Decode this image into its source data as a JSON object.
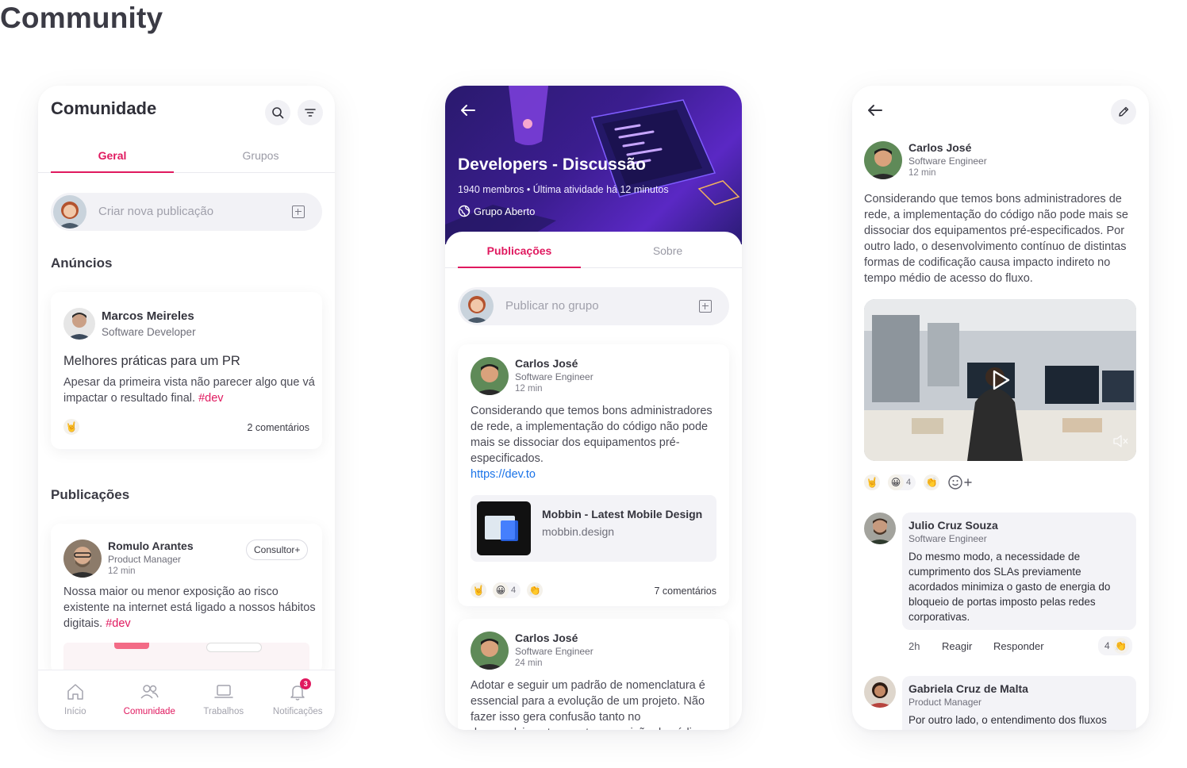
{
  "page": {
    "title": "Community"
  },
  "colors": {
    "accent": "#e0195f",
    "link": "#1a73e8"
  },
  "screen1": {
    "title": "Comunidade",
    "tabs": [
      {
        "label": "Geral",
        "active": true
      },
      {
        "label": "Grupos",
        "active": false
      }
    ],
    "composer_placeholder": "Criar nova publicação",
    "announcements_heading": "Anúncios",
    "announcement": {
      "author": "Marcos Meireles",
      "role": "Software Developer",
      "title": "Melhores práticas para um PR",
      "body": "Apesar da primeira vista não parecer algo que vá impactar o resultado final.",
      "tag": "#dev",
      "comments": "2 comentários"
    },
    "posts_heading": "Publicações",
    "post": {
      "author": "Romulo Arantes",
      "role": "Product Manager",
      "time": "12 min",
      "badge": "Consultor+",
      "body": "Nossa maior ou menor exposição ao risco existente na internet está ligado a nossos hábitos digitais.",
      "tag": "#dev"
    },
    "nav": [
      {
        "label": "Início",
        "icon": "home-icon",
        "active": false
      },
      {
        "label": "Comunidade",
        "icon": "people-icon",
        "active": true
      },
      {
        "label": "Trabalhos",
        "icon": "laptop-icon",
        "active": false
      },
      {
        "label": "Notificações",
        "icon": "bell-icon",
        "active": false,
        "badge": "3"
      }
    ]
  },
  "screen2": {
    "group_title": "Developers - Discussão",
    "group_meta": "1940 membros • Última atividade há 12 minutos",
    "group_type": "Grupo Aberto",
    "tabs": [
      {
        "label": "Publicações",
        "active": true
      },
      {
        "label": "Sobre",
        "active": false
      }
    ],
    "composer_placeholder": "Publicar no grupo",
    "post1": {
      "author": "Carlos José",
      "role": "Software Engineer",
      "time": "12 min",
      "body": "Considerando que temos bons administradores de rede, a implementação do código não pode mais se dissociar dos equipamentos pré-especificados.",
      "link": "https://dev.to",
      "preview_title": "Mobbin - Latest Mobile Design",
      "preview_domain": "mobbin.design",
      "reaction_count": "4",
      "comments": "7 comentários"
    },
    "post2": {
      "author": "Carlos José",
      "role": "Software Engineer",
      "time": "24 min",
      "body": "Adotar e seguir um padrão de nomenclatura é essencial para a evolução de um projeto. Não fazer isso gera confusão tanto no desenvolvimento quanto na revisão de código."
    }
  },
  "screen3": {
    "author": "Carlos José",
    "role": "Software Engineer",
    "time": "12 min",
    "body": "Considerando que temos bons administradores de rede, a implementação do código não pode mais se dissociar dos equipamentos pré-especificados. Por outro lado, o desenvolvimento contínuo de distintas formas de codificação causa impacto indireto no tempo médio de acesso do fluxo.",
    "reaction_count": "4",
    "comment1": {
      "author": "Julio Cruz Souza",
      "role": "Software Engineer",
      "body": "Do mesmo modo, a necessidade de cumprimento dos SLAs previamente acordados minimiza o gasto de energia do bloqueio de portas imposto pelas redes corporativas.",
      "time": "2h",
      "react_label": "Reagir",
      "reply_label": "Responder",
      "reaction_count": "4"
    },
    "comment2": {
      "author": "Gabriela Cruz de Malta",
      "role": "Product Manager",
      "body": "Por outro lado, o entendimento dos fluxos"
    }
  }
}
